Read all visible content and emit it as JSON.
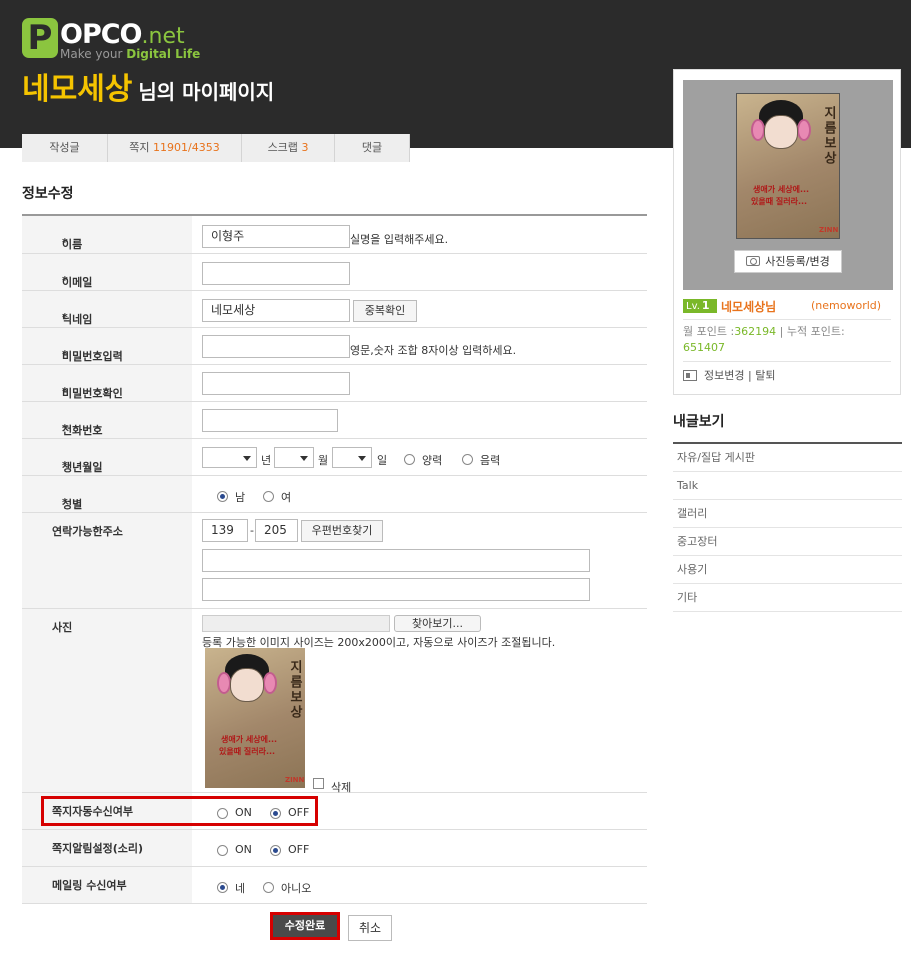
{
  "header": {
    "logo_text": "POPCO.net",
    "logo_slogan_prefix": "Make your ",
    "logo_slogan_bold": "Digital Life",
    "user_nick": "네모세상",
    "title_suffix": "님의 마이페이지",
    "bg_color": "#2b2b2b",
    "accent_color": "#f5c400"
  },
  "tabs": [
    {
      "label": "작성글",
      "count": ""
    },
    {
      "label": "쪽지",
      "count": "11901/4353"
    },
    {
      "label": "스크랩",
      "count": "3"
    },
    {
      "label": "댓글",
      "count": ""
    }
  ],
  "section_title": "정보수정",
  "form": {
    "name": {
      "label": "이름",
      "value": "이형주",
      "help": "실명을 입력해주세요."
    },
    "email": {
      "label": "이메일",
      "value": ""
    },
    "nickname": {
      "label": "닉네임",
      "value": "네모세상",
      "check_button": "중복확인"
    },
    "password": {
      "label": "비밀번호입력",
      "value": "",
      "help": "영문,숫자 조합 8자이상 입력하세요."
    },
    "password_confirm": {
      "label": "비밀번호확인",
      "value": ""
    },
    "phone": {
      "label": "전화번호",
      "value": ""
    },
    "birth": {
      "label": "생년월일",
      "year_label": "년",
      "month_label": "월",
      "day_label": "일",
      "solar": "양력",
      "lunar": "음력"
    },
    "gender": {
      "label": "성별",
      "male": "남",
      "female": "여",
      "selected": "male"
    },
    "address": {
      "label": "연락가능한주소",
      "zip1": "139",
      "zip_sep": "-",
      "zip2": "205",
      "find_button": "우편번호찾기",
      "line1": "",
      "line2": ""
    },
    "photo": {
      "label": "사진",
      "browse_button": "찾아보기...",
      "help": "등록 가능한 이미지 사이즈는 200x200이고, 자동으로 사이즈가 조절됩니다.",
      "delete_label": "삭제",
      "vertical_text": "지름보상",
      "red_line1": "생애가 세상에...",
      "red_line2": "있을때 질러라...",
      "tag": "ZINN"
    },
    "msg_auto": {
      "label": "쪽지자동수신여부",
      "on": "ON",
      "off": "OFF",
      "selected": "off"
    },
    "msg_sound": {
      "label": "쪽지알림설정(소리)",
      "on": "ON",
      "off": "OFF",
      "selected": "off"
    },
    "mailing": {
      "label": "메일링 수신여부",
      "yes": "네",
      "no": "아니오",
      "selected": "yes"
    },
    "submit": "수정완료",
    "cancel": "취소"
  },
  "sidebar": {
    "photo_button": "사진등록/변경",
    "level_prefix": "Lv.",
    "level": "1",
    "name": "네모세상님",
    "user_id": "(nemoworld)",
    "month_points_label": "월 포인트 :",
    "month_points": "362194",
    "points_sep": " | 누적 포인트:",
    "total_points": "651407",
    "link_edit": "정보변경",
    "link_sep": "|",
    "link_leave": "탈퇴"
  },
  "my_posts": {
    "title": "내글보기",
    "items": [
      "자유/질답 게시판",
      "Talk",
      "갤러리",
      "중고장터",
      "사용기",
      "기타"
    ]
  }
}
